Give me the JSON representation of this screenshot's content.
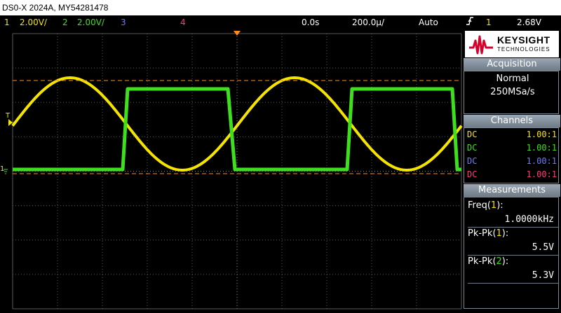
{
  "title": "DS0-X 2024A, MY54281478",
  "status": {
    "ch1_num": "1",
    "ch1_scale": "2.00V/",
    "ch2_num": "2",
    "ch2_scale": "2.00V/",
    "ch3_num": "3",
    "ch4_num": "4",
    "time_delay": "0.0s",
    "time_scale": "200.0µ/",
    "trigger_mode": "Auto",
    "trigger_slope_icon": "rising-edge-icon",
    "trigger_source": "1",
    "trigger_level": "2.68V"
  },
  "colors": {
    "ch1": "#f5e400",
    "ch2": "#3ee01e",
    "ch3": "#6a7cff",
    "ch4": "#ff3a78",
    "trigger_marker": "#ff8c1a"
  },
  "logo": {
    "brand": "KEYSIGHT",
    "sub": "TECHNOLOGIES"
  },
  "acquisition": {
    "header": "Acquisition",
    "mode": "Normal",
    "rate": "250MSa/s"
  },
  "channels": {
    "header": "Channels",
    "rows": [
      {
        "coupling": "DC",
        "ratio": "1.00:1"
      },
      {
        "coupling": "DC",
        "ratio": "1.00:1"
      },
      {
        "coupling": "DC",
        "ratio": "1.00:1"
      },
      {
        "coupling": "DC",
        "ratio": "1.00:1"
      }
    ]
  },
  "measurements": {
    "header": "Measurements",
    "items": [
      {
        "name": "Freq",
        "channel": "1",
        "value": "1.0000kHz"
      },
      {
        "name": "Pk-Pk",
        "channel": "1",
        "value": "5.5V"
      },
      {
        "name": "Pk-Pk",
        "channel": "2",
        "value": "5.3V"
      }
    ]
  },
  "markers": {
    "trigger_level_label": "T",
    "ground_label": "1"
  }
}
